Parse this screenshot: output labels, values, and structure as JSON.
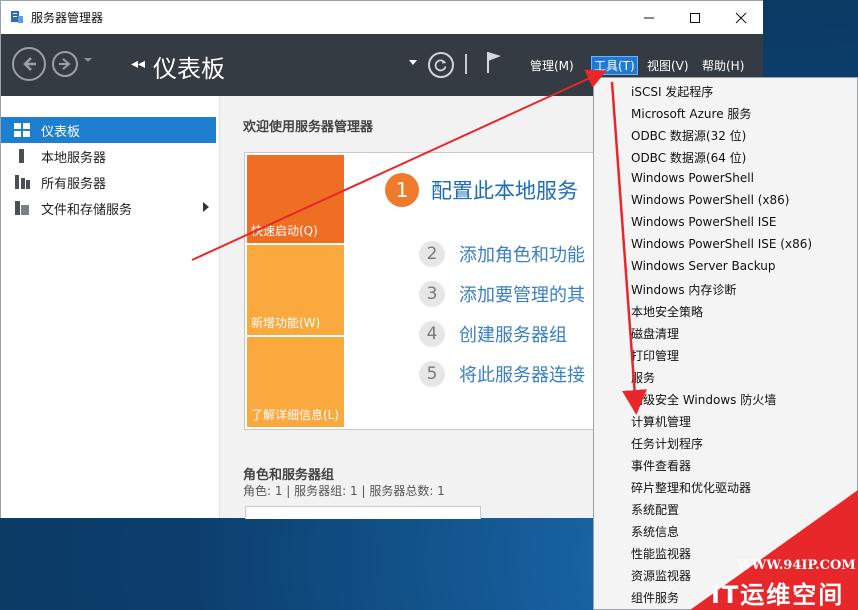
{
  "window": {
    "title": "服务器管理器",
    "minimize_glyph": "—",
    "close_glyph": "✕"
  },
  "header": {
    "breadcrumb_arrows": "◂◂",
    "page_title": "仪表板",
    "menus": {
      "manage": "管理(M)",
      "tools": "工具(T)",
      "view": "视图(V)",
      "help": "帮助(H)"
    }
  },
  "sidebar": {
    "items": [
      {
        "label": "仪表板",
        "icon": "dashboard-icon"
      },
      {
        "label": "本地服务器",
        "icon": "server-icon"
      },
      {
        "label": "所有服务器",
        "icon": "servers-icon"
      },
      {
        "label": "文件和存储服务",
        "icon": "storage-icon"
      }
    ]
  },
  "main": {
    "welcome_title": "欢迎使用服务器管理器",
    "tiles": [
      "快速启动(Q)",
      "新增功能(W)",
      "了解详细信息(L)"
    ],
    "steps": [
      {
        "num": "1",
        "text": "配置此本地服务"
      },
      {
        "num": "2",
        "text": "添加角色和功能"
      },
      {
        "num": "3",
        "text": "添加要管理的其"
      },
      {
        "num": "4",
        "text": "创建服务器组"
      },
      {
        "num": "5",
        "text": "将此服务器连接"
      }
    ],
    "roles_title": "角色和服务器组",
    "roles_summary": "角色: 1 | 服务器组: 1 | 服务器总数: 1"
  },
  "tools_menu": {
    "items": [
      "iSCSI 发起程序",
      "Microsoft Azure 服务",
      "ODBC 数据源(32 位)",
      "ODBC 数据源(64 位)",
      "Windows PowerShell",
      "Windows PowerShell (x86)",
      "Windows PowerShell ISE",
      "Windows PowerShell ISE (x86)",
      "Windows Server Backup",
      "Windows 内存诊断",
      "本地安全策略",
      "磁盘清理",
      "打印管理",
      "服务",
      "高级安全 Windows 防火墙",
      "计算机管理",
      "任务计划程序",
      "事件查看器",
      "碎片整理和优化驱动器",
      "系统配置",
      "系统信息",
      "性能监视器",
      "资源监视器",
      "组件服务"
    ]
  },
  "watermark": {
    "url": "WWW.94IP.COM",
    "brand": "IT运维空间"
  },
  "colors": {
    "header_bg": "#343b42",
    "accent": "#1e7fd0",
    "tile_orange": "#ef6e23",
    "tile_light": "#f9a93e",
    "arrow_red": "#e8272b"
  }
}
